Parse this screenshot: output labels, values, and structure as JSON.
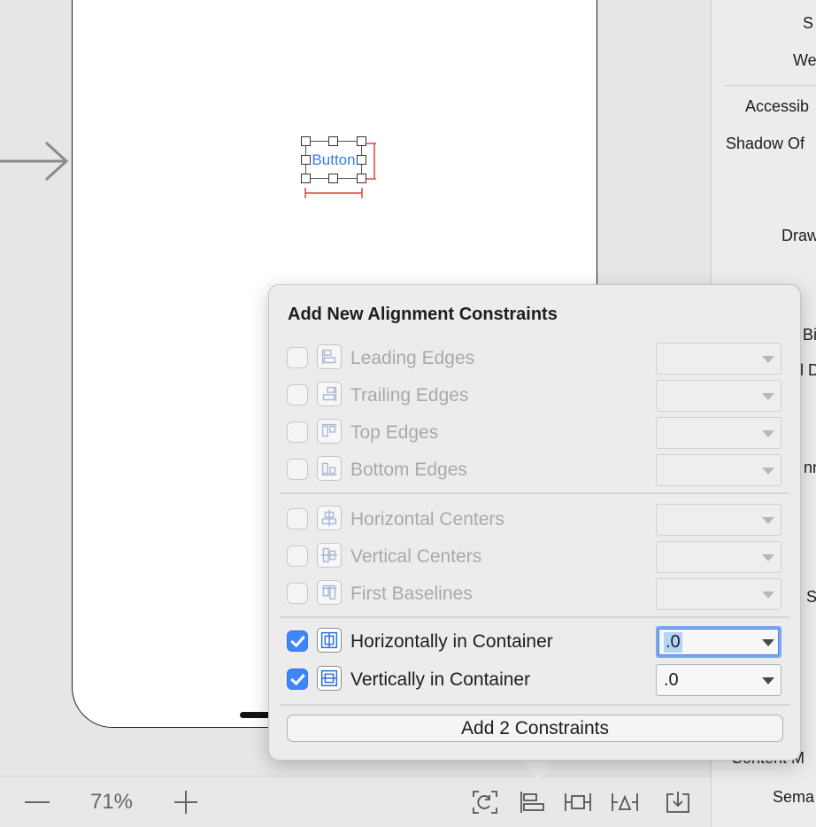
{
  "canvas": {
    "button_label": "Button"
  },
  "inspector": {
    "labels": [
      "S",
      "We",
      "Accessib",
      "Shadow Of",
      "Draw",
      "Bi",
      "l D",
      "nn",
      "S",
      "Content M",
      "Sema"
    ]
  },
  "bottombar": {
    "zoom_out": "—",
    "zoom_level": "71%",
    "zoom_in": "+",
    "tools": [
      "update-frames-icon",
      "align-icon",
      "add-constraints-icon",
      "resolve-issues-icon",
      "embed-in-icon"
    ]
  },
  "popover": {
    "title": "Add New Alignment Constraints",
    "rows": [
      {
        "label": "Leading Edges",
        "checked": false,
        "enabled": false,
        "value": ""
      },
      {
        "label": "Trailing Edges",
        "checked": false,
        "enabled": false,
        "value": ""
      },
      {
        "label": "Top Edges",
        "checked": false,
        "enabled": false,
        "value": ""
      },
      {
        "label": "Bottom Edges",
        "checked": false,
        "enabled": false,
        "value": ""
      },
      {
        "label": "Horizontal Centers",
        "checked": false,
        "enabled": false,
        "value": ""
      },
      {
        "label": "Vertical Centers",
        "checked": false,
        "enabled": false,
        "value": ""
      },
      {
        "label": "First Baselines",
        "checked": false,
        "enabled": false,
        "value": ""
      },
      {
        "label": "Horizontally in Container",
        "checked": true,
        "enabled": true,
        "value": ".0"
      },
      {
        "label": "Vertically in Container",
        "checked": true,
        "enabled": true,
        "value": ".0"
      }
    ],
    "add_button": "Add 2 Constraints"
  },
  "colors": {
    "accent": "#3d86f5",
    "constraint_red": "#e0463a",
    "button_text": "#2f7fe6"
  }
}
